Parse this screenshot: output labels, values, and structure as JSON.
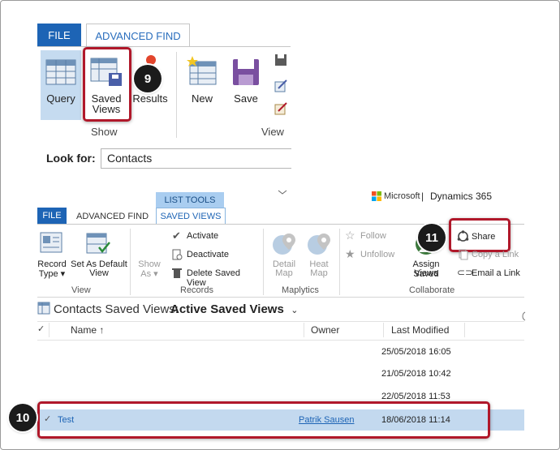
{
  "top_ribbon": {
    "tab_file": "FILE",
    "tab_advanced_find": "ADVANCED FIND",
    "query_label": "Query",
    "saved_views_label_1": "Saved",
    "saved_views_label_2": "Views",
    "results_label": "Results",
    "show_group": "Show",
    "new_label": "New",
    "save_label": "Save",
    "view_group": "View",
    "look_for_label": "Look for:",
    "look_for_value": "Contacts"
  },
  "second_ribbon": {
    "list_tools": "LIST TOOLS",
    "tab_file": "FILE",
    "tab_advanced_find": "ADVANCED FIND",
    "tab_saved_views": "SAVED VIEWS",
    "brand_microsoft": "Microsoft",
    "brand_separator": "|",
    "brand_product": "Dynamics 365",
    "record_type_1": "Record",
    "record_type_2": "Type ▾",
    "set_default_1": "Set As Default",
    "set_default_2": "View",
    "view_group": "View",
    "show_as_1": "Show",
    "show_as_2": "As ▾",
    "activate": "Activate",
    "deactivate": "Deactivate",
    "delete_saved_view": "Delete Saved View",
    "records_group": "Records",
    "detail_map_1": "Detail",
    "detail_map_2": "Map",
    "heat_map_1": "Heat",
    "heat_map_2": "Map",
    "maplytics_group": "Maplytics",
    "follow": "Follow",
    "unfollow": "Unfollow",
    "assign_saved_views_1": "Assign Saved",
    "assign_saved_views_2": "Views",
    "share": "Share",
    "copy_link": "Copy a Link",
    "email_link": "Email a Link",
    "collaborate_group": "Collaborate"
  },
  "view_header": {
    "prefix": "Contacts Saved Views:",
    "selected_view": "Active Saved Views"
  },
  "grid": {
    "columns": [
      "Name ↑",
      "Owner",
      "Last Modified"
    ],
    "rows": [
      {
        "name": "",
        "owner": "",
        "modified": "25/05/2018 16:05"
      },
      {
        "name": "",
        "owner": "",
        "modified": "21/05/2018 10:42"
      },
      {
        "name": "",
        "owner": "",
        "modified": "22/05/2018 11:53"
      },
      {
        "name": "Test",
        "owner": "Patrik Sausen",
        "modified": "18/06/2018 11:14"
      }
    ]
  },
  "badges": {
    "b9": "9",
    "b10": "10",
    "b11": "11"
  },
  "colors": {
    "accent": "#1d64b5",
    "highlight": "#b0182a",
    "selected_row": "#c3d9ef"
  }
}
